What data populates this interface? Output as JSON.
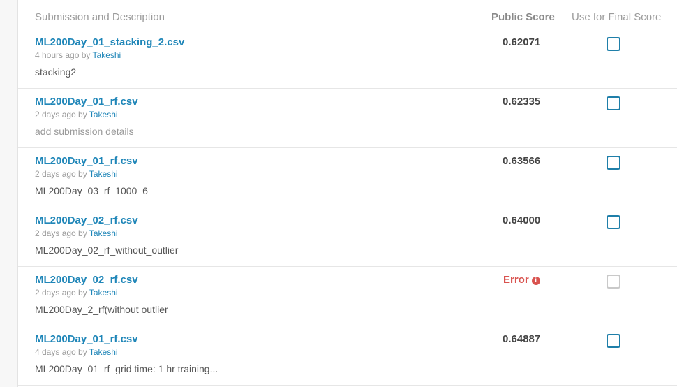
{
  "header": {
    "submission_label": "Submission and Description",
    "public_score_label": "Public Score",
    "final_score_label": "Use for Final Score"
  },
  "submissions": [
    {
      "file": "ML200Day_01_stacking_2.csv",
      "time": "4 hours ago by",
      "user": "Takeshi",
      "description": "stacking2",
      "score": "0.62071",
      "error": false
    },
    {
      "file": "ML200Day_01_rf.csv",
      "time": "2 days ago by",
      "user": "Takeshi",
      "description": "add submission details",
      "placeholder": true,
      "score": "0.62335",
      "error": false
    },
    {
      "file": "ML200Day_01_rf.csv",
      "time": "2 days ago by",
      "user": "Takeshi",
      "description": "ML200Day_03_rf_1000_6",
      "score": "0.63566",
      "error": false
    },
    {
      "file": "ML200Day_02_rf.csv",
      "time": "2 days ago by",
      "user": "Takeshi",
      "description": "ML200Day_02_rf_without_outlier",
      "score": "0.64000",
      "error": false
    },
    {
      "file": "ML200Day_02_rf.csv",
      "time": "2 days ago by",
      "user": "Takeshi",
      "description": "ML200Day_2_rf(without outlier",
      "score": "Error",
      "error": true
    },
    {
      "file": "ML200Day_01_rf.csv",
      "time": "4 days ago by",
      "user": "Takeshi",
      "description": "ML200Day_01_rf_grid time: 1 hr training...",
      "score": "0.64887",
      "error": false
    }
  ],
  "colors": {
    "link": "#1f86b8",
    "error": "#d9534f",
    "checkbox": "#1f7fa9"
  },
  "icons": {
    "error": "info-circle-icon"
  }
}
